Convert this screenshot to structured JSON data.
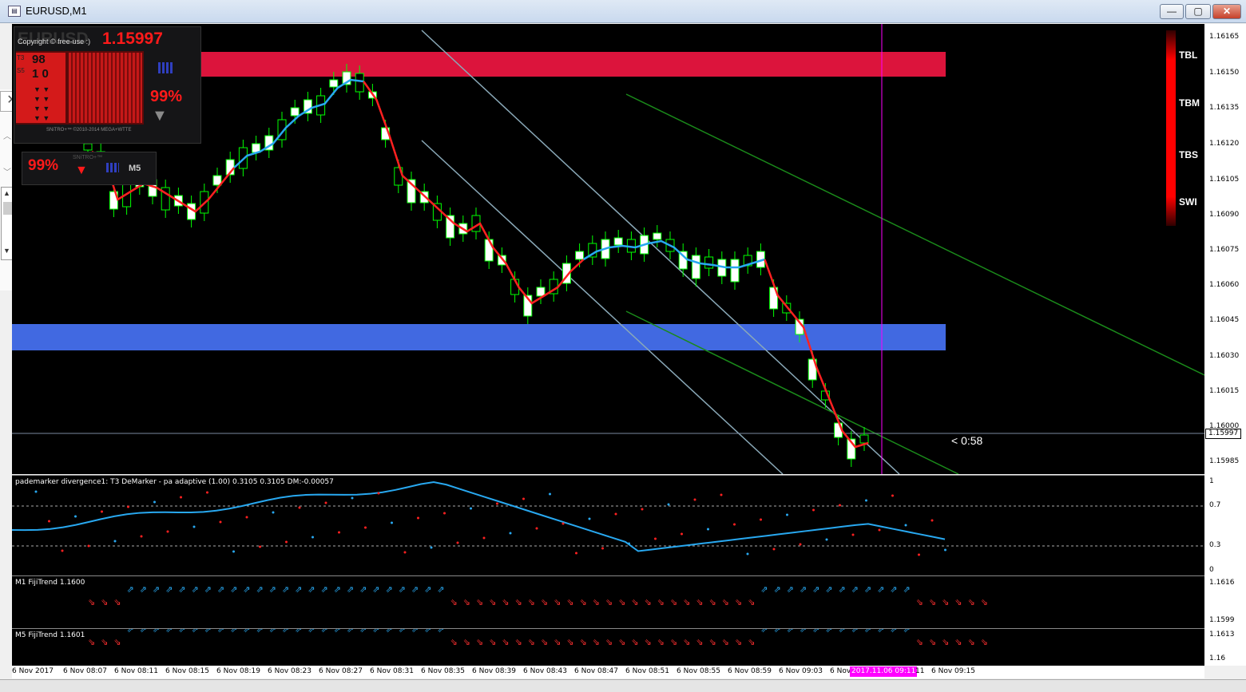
{
  "window": {
    "title": "EURUSD,M1",
    "buttons": {
      "minimize": "—",
      "restore": "▢",
      "close": "✕"
    }
  },
  "price_axis": {
    "ticks": [
      "1.16165",
      "1.16150",
      "1.16135",
      "1.16120",
      "1.16105",
      "1.16090",
      "1.16075",
      "1.16060",
      "1.16045",
      "1.16030",
      "1.16015",
      "1.16000",
      "1.15985"
    ],
    "current_price": "1.15997"
  },
  "main_chart": {
    "countdown": "< 0:58",
    "tb_labels": [
      "TBL",
      "TBM",
      "TBS",
      "SWI"
    ],
    "colors": {
      "bull_candle": "#ffffff",
      "wick": "#00ff00",
      "resistance_zone": "#dc143c",
      "support_zone": "#4169e1",
      "channel_green": "#1a8a1a",
      "channel_gray": "#8aa9b8",
      "vline": "#ff00ff"
    }
  },
  "widget": {
    "symbol": "EURUSD",
    "price": "1.15997",
    "copyright": "Copyright © free-use :)",
    "value_top": "98",
    "value_mid": "1 0",
    "row_labels": [
      "T3",
      "S5",
      "S5",
      "M5"
    ],
    "percent": "99%",
    "footer": "SNiTRO+™ ©2010-2014 MEGA+WTTE",
    "percent2": "99%",
    "brand2": "SNiTRO+™",
    "tf2": "M5"
  },
  "indicator_pane": {
    "label": "pademarker divergence1: T3 DeMarker - pa adaptive (1.00) 0.3105 0.3105  DM:-0.00057",
    "levels": [
      "1",
      "0.7",
      "0.3",
      "0"
    ]
  },
  "fiji_m1": {
    "label": "M1 FijiTrend 1.1600",
    "levels": [
      "1.1616",
      "1.1599"
    ]
  },
  "fiji_m5": {
    "label": "M5 FijiTrend 1.1601",
    "levels": [
      "1.1613",
      "1.16"
    ]
  },
  "time_axis": {
    "labels": [
      "6 Nov 2017",
      "6 Nov 08:07",
      "6 Nov 08:11",
      "6 Nov 08:15",
      "6 Nov 08:19",
      "6 Nov 08:23",
      "6 Nov 08:27",
      "6 Nov 08:31",
      "6 Nov 08:35",
      "6 Nov 08:39",
      "6 Nov 08:43",
      "6 Nov 08:47",
      "6 Nov 08:51",
      "6 Nov 08:55",
      "6 Nov 08:59",
      "6 Nov 09:03",
      "6 Nov",
      "11",
      "6 Nov 09:15"
    ],
    "highlight": "2017.11.06 09:11"
  },
  "chart_data": {
    "type": "candlestick",
    "symbol": "EURUSD",
    "timeframe": "M1",
    "ylim": [
      1.15975,
      1.16172
    ],
    "last_price": 1.15997
  }
}
